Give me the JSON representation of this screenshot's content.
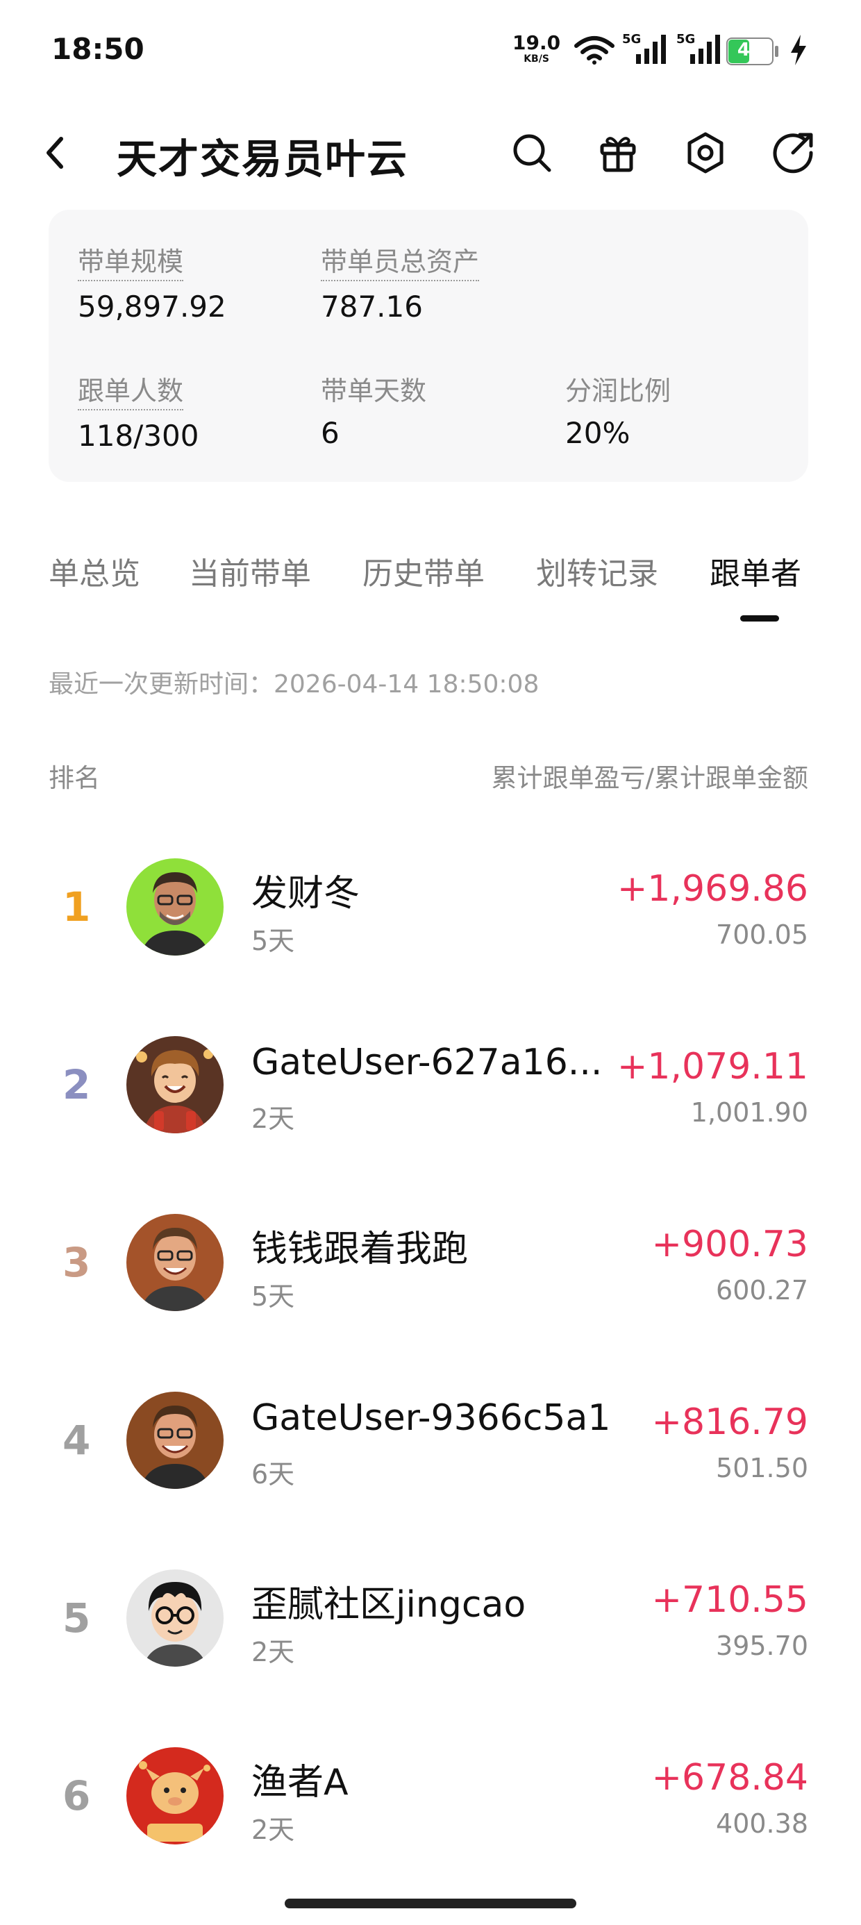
{
  "status_bar": {
    "time": "18:50",
    "net_speed": "19.0",
    "net_unit": "KB/S",
    "signal_1_label": "5G",
    "signal_2_label": "5G",
    "battery": "42",
    "battery_level": 0.42
  },
  "header": {
    "title": "天才交易员叶云",
    "icons": [
      "back-icon",
      "search-icon",
      "gift-icon",
      "settings-icon",
      "share-icon"
    ]
  },
  "stats": {
    "scale_label": "带单规模",
    "scale_value": "59,897.92",
    "assets_label": "带单员总资产",
    "assets_value": "787.16",
    "followers_label": "跟单人数",
    "followers_value": "118/300",
    "days_label": "带单天数",
    "days_value": "6",
    "share_label": "分润比例",
    "share_value": "20%"
  },
  "tabs": [
    {
      "label": "单总览"
    },
    {
      "label": "当前带单"
    },
    {
      "label": "历史带单"
    },
    {
      "label": "划转记录"
    },
    {
      "label": "跟单者",
      "active": true
    }
  ],
  "updated": "最近一次更新时间：2026-04-14 18:50:08",
  "columns": {
    "left": "排名",
    "right": "累计跟单盈亏/累计跟单金额"
  },
  "followers": [
    {
      "rank": "1",
      "name": "发财冬",
      "days": "5天",
      "pnl": "+1,969.86",
      "amount": "700.05"
    },
    {
      "rank": "2",
      "name": "GateUser-627a16...",
      "days": "2天",
      "pnl": "+1,079.11",
      "amount": "1,001.90"
    },
    {
      "rank": "3",
      "name": "钱钱跟着我跑",
      "days": "5天",
      "pnl": "+900.73",
      "amount": "600.27"
    },
    {
      "rank": "4",
      "name": "GateUser-9366c5a1",
      "days": "6天",
      "pnl": "+816.79",
      "amount": "501.50"
    },
    {
      "rank": "5",
      "name": "歪腻社区jingcao",
      "days": "2天",
      "pnl": "+710.55",
      "amount": "395.70"
    },
    {
      "rank": "6",
      "name": "渔者A",
      "days": "2天",
      "pnl": "+678.84",
      "amount": "400.38"
    }
  ],
  "colors": {
    "gain": "#e8325a",
    "rank_1": "#f0a020",
    "rank_2": "#8b8fc0",
    "rank_3": "#c99a84",
    "rank_other": "#a0a0a0"
  }
}
